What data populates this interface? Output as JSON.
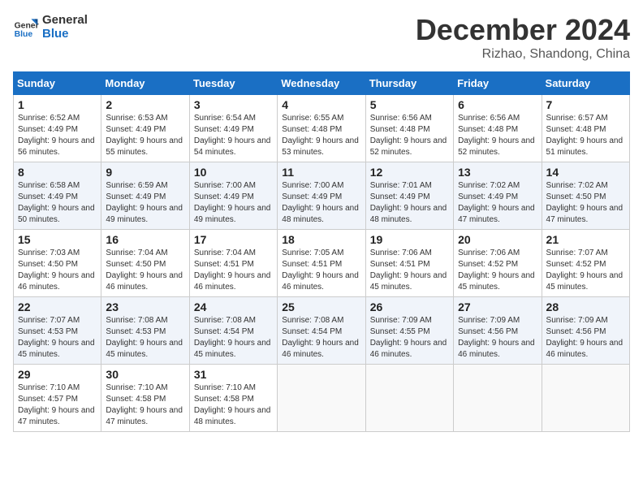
{
  "logo": {
    "line1": "General",
    "line2": "Blue"
  },
  "title": "December 2024",
  "location": "Rizhao, Shandong, China",
  "days_of_week": [
    "Sunday",
    "Monday",
    "Tuesday",
    "Wednesday",
    "Thursday",
    "Friday",
    "Saturday"
  ],
  "weeks": [
    [
      {
        "day": "1",
        "sunrise": "6:52 AM",
        "sunset": "4:49 PM",
        "daylight": "9 hours and 56 minutes."
      },
      {
        "day": "2",
        "sunrise": "6:53 AM",
        "sunset": "4:49 PM",
        "daylight": "9 hours and 55 minutes."
      },
      {
        "day": "3",
        "sunrise": "6:54 AM",
        "sunset": "4:49 PM",
        "daylight": "9 hours and 54 minutes."
      },
      {
        "day": "4",
        "sunrise": "6:55 AM",
        "sunset": "4:48 PM",
        "daylight": "9 hours and 53 minutes."
      },
      {
        "day": "5",
        "sunrise": "6:56 AM",
        "sunset": "4:48 PM",
        "daylight": "9 hours and 52 minutes."
      },
      {
        "day": "6",
        "sunrise": "6:56 AM",
        "sunset": "4:48 PM",
        "daylight": "9 hours and 52 minutes."
      },
      {
        "day": "7",
        "sunrise": "6:57 AM",
        "sunset": "4:48 PM",
        "daylight": "9 hours and 51 minutes."
      }
    ],
    [
      {
        "day": "8",
        "sunrise": "6:58 AM",
        "sunset": "4:49 PM",
        "daylight": "9 hours and 50 minutes."
      },
      {
        "day": "9",
        "sunrise": "6:59 AM",
        "sunset": "4:49 PM",
        "daylight": "9 hours and 49 minutes."
      },
      {
        "day": "10",
        "sunrise": "7:00 AM",
        "sunset": "4:49 PM",
        "daylight": "9 hours and 49 minutes."
      },
      {
        "day": "11",
        "sunrise": "7:00 AM",
        "sunset": "4:49 PM",
        "daylight": "9 hours and 48 minutes."
      },
      {
        "day": "12",
        "sunrise": "7:01 AM",
        "sunset": "4:49 PM",
        "daylight": "9 hours and 48 minutes."
      },
      {
        "day": "13",
        "sunrise": "7:02 AM",
        "sunset": "4:49 PM",
        "daylight": "9 hours and 47 minutes."
      },
      {
        "day": "14",
        "sunrise": "7:02 AM",
        "sunset": "4:50 PM",
        "daylight": "9 hours and 47 minutes."
      }
    ],
    [
      {
        "day": "15",
        "sunrise": "7:03 AM",
        "sunset": "4:50 PM",
        "daylight": "9 hours and 46 minutes."
      },
      {
        "day": "16",
        "sunrise": "7:04 AM",
        "sunset": "4:50 PM",
        "daylight": "9 hours and 46 minutes."
      },
      {
        "day": "17",
        "sunrise": "7:04 AM",
        "sunset": "4:51 PM",
        "daylight": "9 hours and 46 minutes."
      },
      {
        "day": "18",
        "sunrise": "7:05 AM",
        "sunset": "4:51 PM",
        "daylight": "9 hours and 46 minutes."
      },
      {
        "day": "19",
        "sunrise": "7:06 AM",
        "sunset": "4:51 PM",
        "daylight": "9 hours and 45 minutes."
      },
      {
        "day": "20",
        "sunrise": "7:06 AM",
        "sunset": "4:52 PM",
        "daylight": "9 hours and 45 minutes."
      },
      {
        "day": "21",
        "sunrise": "7:07 AM",
        "sunset": "4:52 PM",
        "daylight": "9 hours and 45 minutes."
      }
    ],
    [
      {
        "day": "22",
        "sunrise": "7:07 AM",
        "sunset": "4:53 PM",
        "daylight": "9 hours and 45 minutes."
      },
      {
        "day": "23",
        "sunrise": "7:08 AM",
        "sunset": "4:53 PM",
        "daylight": "9 hours and 45 minutes."
      },
      {
        "day": "24",
        "sunrise": "7:08 AM",
        "sunset": "4:54 PM",
        "daylight": "9 hours and 45 minutes."
      },
      {
        "day": "25",
        "sunrise": "7:08 AM",
        "sunset": "4:54 PM",
        "daylight": "9 hours and 46 minutes."
      },
      {
        "day": "26",
        "sunrise": "7:09 AM",
        "sunset": "4:55 PM",
        "daylight": "9 hours and 46 minutes."
      },
      {
        "day": "27",
        "sunrise": "7:09 AM",
        "sunset": "4:56 PM",
        "daylight": "9 hours and 46 minutes."
      },
      {
        "day": "28",
        "sunrise": "7:09 AM",
        "sunset": "4:56 PM",
        "daylight": "9 hours and 46 minutes."
      }
    ],
    [
      {
        "day": "29",
        "sunrise": "7:10 AM",
        "sunset": "4:57 PM",
        "daylight": "9 hours and 47 minutes."
      },
      {
        "day": "30",
        "sunrise": "7:10 AM",
        "sunset": "4:58 PM",
        "daylight": "9 hours and 47 minutes."
      },
      {
        "day": "31",
        "sunrise": "7:10 AM",
        "sunset": "4:58 PM",
        "daylight": "9 hours and 48 minutes."
      },
      null,
      null,
      null,
      null
    ]
  ]
}
